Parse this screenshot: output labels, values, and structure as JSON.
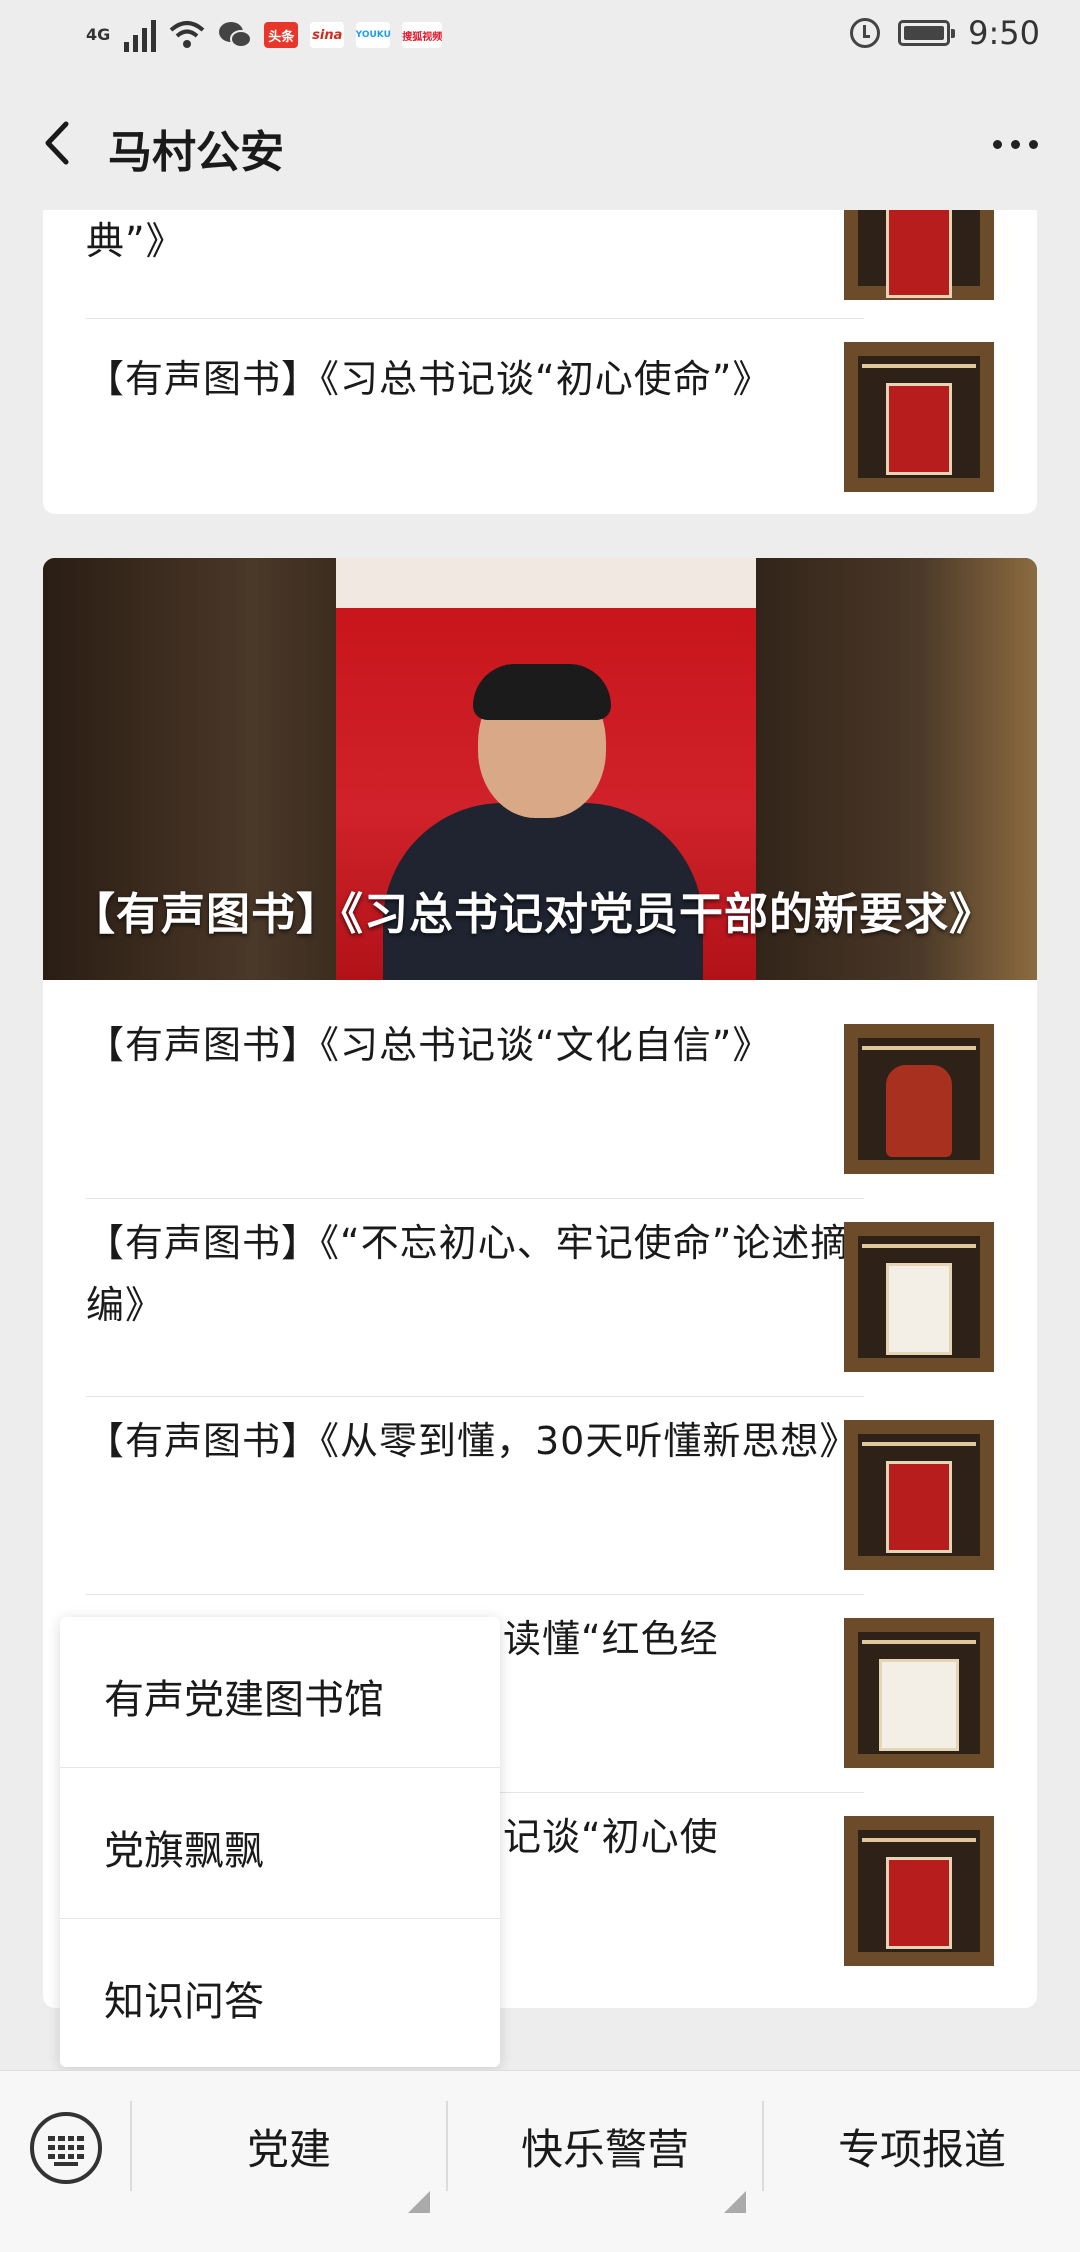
{
  "status_bar": {
    "network": "4G",
    "apps": [
      "头条",
      "sina",
      "YOUKU",
      "搜狐视频"
    ],
    "time": "9:50"
  },
  "nav": {
    "title": "马村公安",
    "back_icon": "chevron-left-icon",
    "more_icon": "more-dots-icon"
  },
  "card1": {
    "items": [
      {
        "title": "典”》"
      },
      {
        "title": "【有声图书】《习总书记谈“初心使命”》"
      }
    ]
  },
  "card2": {
    "banner_caption": "【有声图书】《习总书记对党员干部的新要求》",
    "items": [
      {
        "title": "【有声图书】《习总书记谈“文化自信”》"
      },
      {
        "title": "【有声图书】《“不忘初心、牢记使命”论述摘编》"
      },
      {
        "title": "【有声图书】《从零到懂，30天听懂新思想》"
      },
      {
        "title": "读懂“红色经"
      },
      {
        "title": "记谈“初心使"
      }
    ]
  },
  "popup_menu": {
    "items": [
      "有声党建图书馆",
      "党旗飘飘",
      "知识问答"
    ]
  },
  "bottom_bar": {
    "keyboard_icon": "keyboard-icon",
    "tabs": [
      "党建",
      "快乐警营",
      "专项报道"
    ]
  }
}
